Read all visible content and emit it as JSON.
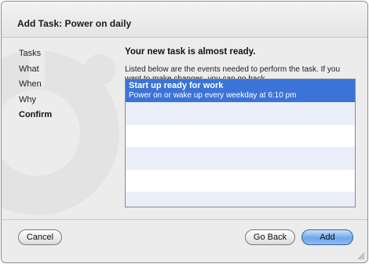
{
  "window": {
    "title": "Add Task: Power on daily"
  },
  "sidebar": {
    "steps": [
      {
        "label": "Tasks"
      },
      {
        "label": "What"
      },
      {
        "label": "When"
      },
      {
        "label": "Why"
      },
      {
        "label": "Confirm",
        "current": true
      }
    ]
  },
  "main": {
    "heading": "Your new task is almost ready.",
    "description": "Listed below are the events needed to perform the task. If you want to make changes, you can go back."
  },
  "events": [
    {
      "title": "Start up ready for work",
      "subtitle": "Power on or wake up every weekday at 6:10 pm",
      "selected": true
    }
  ],
  "buttons": {
    "cancel": "Cancel",
    "go_back": "Go Back",
    "add": "Add"
  },
  "colors": {
    "selection": "#3b74d6",
    "alt_row": "#e9eef9",
    "default_button": "#6fa6e8"
  }
}
